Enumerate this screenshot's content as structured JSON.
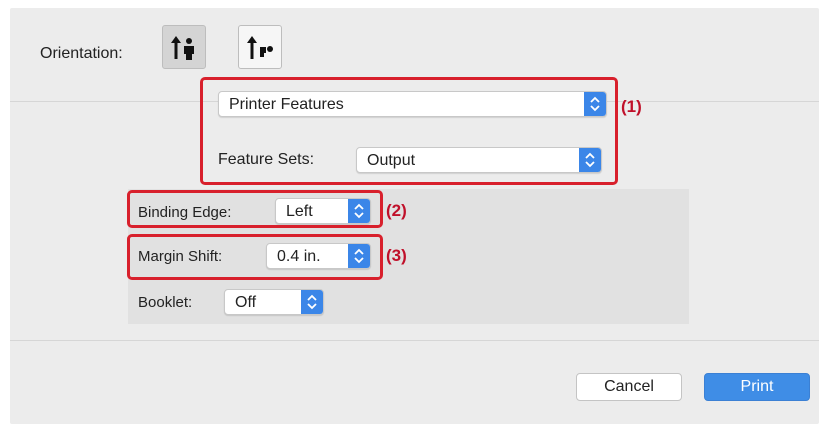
{
  "orientation": {
    "label": "Orientation:",
    "options": [
      {
        "icon": "portrait-orientation-icon",
        "selected": true
      },
      {
        "icon": "landscape-orientation-icon",
        "selected": false
      }
    ]
  },
  "panel_selector": {
    "value": "Printer Features",
    "icon": "up-down-chevron-icon"
  },
  "feature_sets": {
    "label": "Feature Sets:",
    "value": "Output"
  },
  "binding_edge": {
    "label": "Binding Edge:",
    "value": "Left"
  },
  "margin_shift": {
    "label": "Margin Shift:",
    "value": "0.4 in."
  },
  "booklet": {
    "label": "Booklet:",
    "value": "Off"
  },
  "callouts": [
    "(1)",
    "(2)",
    "(3)"
  ],
  "buttons": {
    "cancel": "Cancel",
    "print": "Print"
  },
  "colors": {
    "accent": "#3b86e8",
    "highlight": "#d8202c",
    "callout_text": "#c0102a"
  }
}
